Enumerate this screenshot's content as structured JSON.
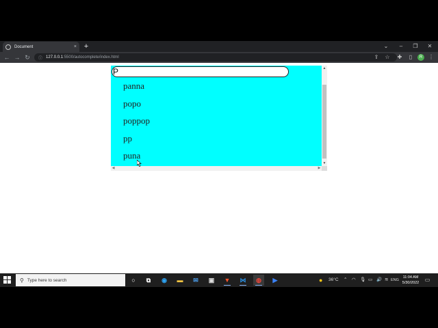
{
  "browser": {
    "tab_title": "Document",
    "tab_close": "×",
    "new_tab": "+",
    "window_controls": {
      "dropdown": "⌄",
      "minimize": "–",
      "restore": "❐",
      "close": "✕"
    },
    "nav": {
      "back": "←",
      "forward": "→",
      "reload": "↻"
    },
    "url_host": "127.0.0.1",
    "url_path": ":5500/autocomplete/index.html",
    "profile_initial": "R"
  },
  "autocomplete": {
    "input_value": "P",
    "suggestions": [
      "panna",
      "popo",
      "poppop",
      "pp",
      "puna"
    ],
    "background": "#00ffff"
  },
  "taskbar": {
    "search_placeholder": "Type here to search",
    "weather": "36°C",
    "language": "ENG",
    "time": "11:04 AM",
    "date": "5/30/2022"
  }
}
